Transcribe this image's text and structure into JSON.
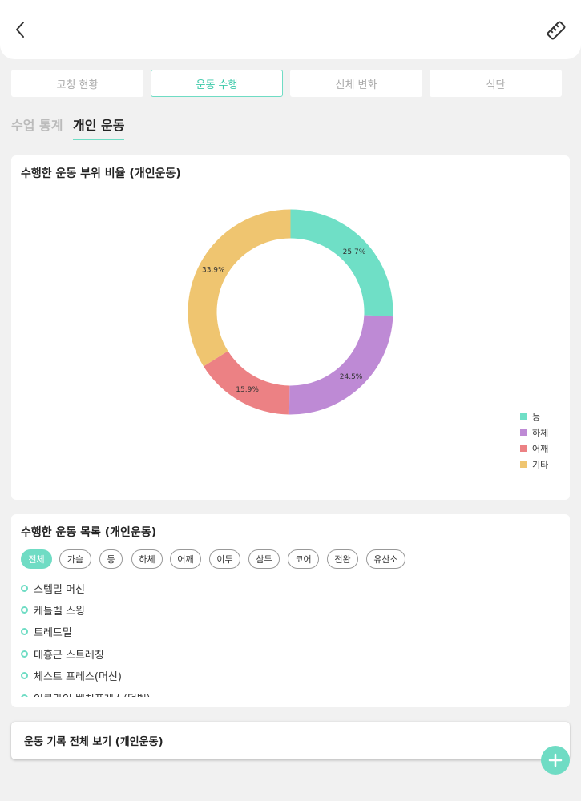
{
  "header": {
    "back_icon": "chevron-left-icon",
    "action_icon": "ruler-icon"
  },
  "tabs": [
    {
      "label": "코칭 현황"
    },
    {
      "label": "운동 수행"
    },
    {
      "label": "신체 변화"
    },
    {
      "label": "식단"
    }
  ],
  "active_tab": 1,
  "subtabs": [
    {
      "label": "수업 통계"
    },
    {
      "label": "개인 운동"
    }
  ],
  "active_subtab": 1,
  "ratio_card": {
    "title": "수행한 운동 부위 비율 (개인운동)"
  },
  "chart_data": {
    "type": "pie",
    "style": "donut",
    "categories": [
      "등",
      "하체",
      "어깨",
      "기타"
    ],
    "values": [
      25.7,
      24.5,
      15.9,
      33.9
    ],
    "labels": [
      "25.7%",
      "24.5%",
      "15.9%",
      "33.9%"
    ],
    "colors": [
      "#6fdfc6",
      "#be8ad5",
      "#ec8184",
      "#efc570"
    ],
    "legend": "bottom-right"
  },
  "list_card": {
    "title": "수행한 운동 목록 (개인운동)",
    "filters": [
      "전체",
      "가슴",
      "등",
      "하체",
      "어깨",
      "이두",
      "삼두",
      "코어",
      "전완",
      "유산소"
    ],
    "active_filter": 0,
    "exercises": [
      "스텝밀 머신",
      "케틀벨 스윙",
      "트레드밀",
      "대흉근 스트레칭",
      "체스트 프레스(머신)",
      "인클라인 벤치프레스(덤벨)"
    ]
  },
  "view_all": {
    "label": "운동 기록 전체 보기 (개인운동)"
  },
  "fab": {
    "icon": "plus-icon"
  },
  "accent_color": "#6fdcc4"
}
